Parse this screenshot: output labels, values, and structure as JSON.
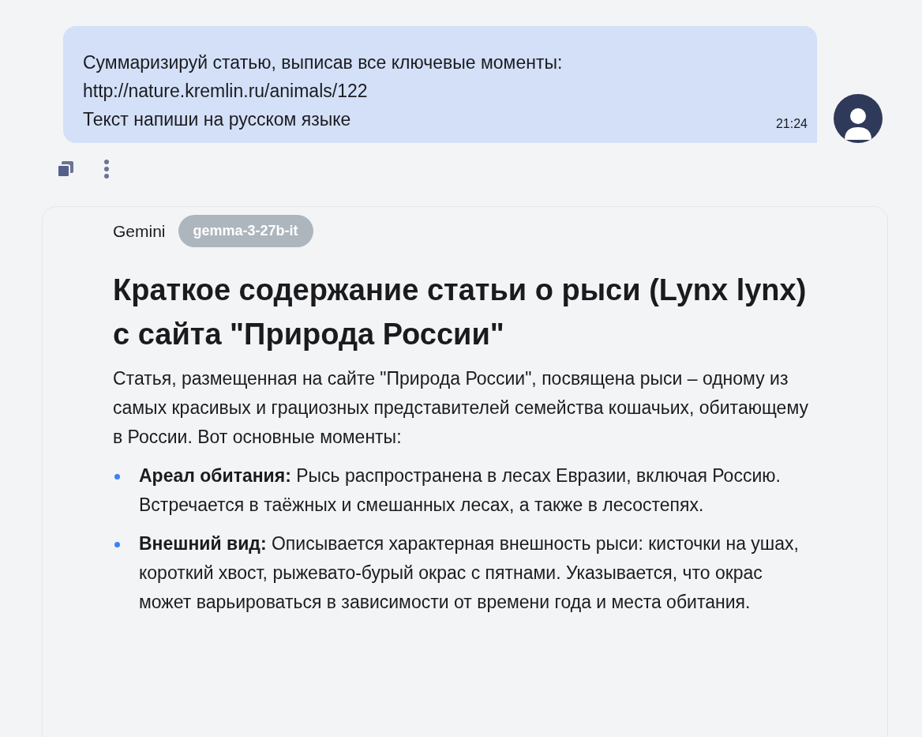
{
  "user_message": {
    "lines": [
      "Суммаризируй статью, выписав все ключевые моменты:",
      "http://nature.kremlin.ru/animals/122",
      "Текст напиши на русском языке"
    ],
    "time": "21:24"
  },
  "response": {
    "author": "Gemini",
    "model": "gemma-3-27b-it",
    "title": "Краткое содержание статьи о рыси (Lynx lynx) с сайта \"Природа России\"",
    "intro": "Статья, размещенная на сайте \"Природа России\", посвящена рыси – одному из самых красивых и грациозных представителей семейства кошачьих, обитающему в России. Вот основные моменты:",
    "bullets": [
      "**Ареал обитания:** Рысь распространена в лесах Евразии, включая Россию. Встречается в таёжных и смешанных лесах, а также в лесостепях.",
      "**Внешний вид:** Описывается характерная внешность рыси: кисточки на ушах, короткий хвост, рыжевато-бурый окрас с пятнами. Указывается, что окрас может варьироваться в зависимости от времени года и места обитания."
    ]
  }
}
